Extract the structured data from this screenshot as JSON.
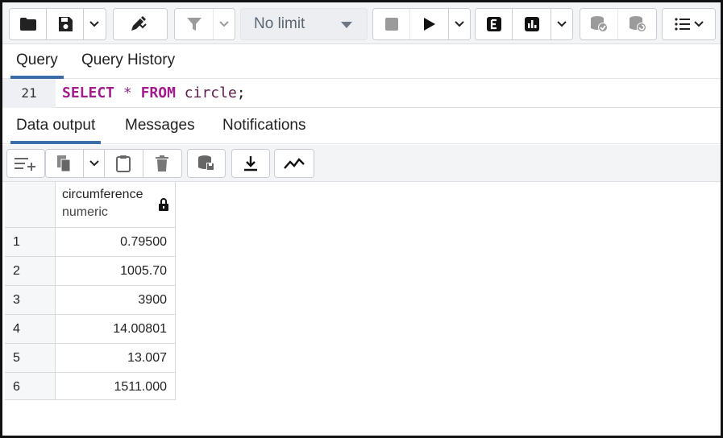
{
  "toolbar": {
    "limit_label": "No limit",
    "buttons": [
      {
        "name": "open-file",
        "icon": "folder-icon"
      },
      {
        "name": "save-file",
        "icon": "floppy-disk-icon"
      },
      {
        "name": "edit",
        "icon": "pen-icon"
      },
      {
        "name": "filter",
        "icon": "filter-icon"
      },
      {
        "name": "stop",
        "icon": "stop-icon"
      },
      {
        "name": "execute",
        "icon": "play-icon"
      },
      {
        "name": "explain",
        "icon": "explain-e-icon"
      },
      {
        "name": "explain-analyze",
        "icon": "bar-chart-icon"
      },
      {
        "name": "commit",
        "icon": "database-check-icon"
      },
      {
        "name": "rollback",
        "icon": "database-rollback-icon"
      },
      {
        "name": "macros",
        "icon": "list-icon"
      }
    ]
  },
  "query_tabs": [
    "Query",
    "Query History"
  ],
  "editor": {
    "line_number": "21",
    "code": {
      "kw1": "SELECT",
      "star": "*",
      "kw2": "FROM",
      "table": "circle",
      "semi": ";"
    }
  },
  "result_tabs": [
    "Data output",
    "Messages",
    "Notifications"
  ],
  "grid": {
    "column": {
      "name": "circumference",
      "type": "numeric"
    },
    "rows": [
      {
        "n": "1",
        "v": "0.79500"
      },
      {
        "n": "2",
        "v": "1005.70"
      },
      {
        "n": "3",
        "v": "3900"
      },
      {
        "n": "4",
        "v": "14.00801"
      },
      {
        "n": "5",
        "v": "13.007"
      },
      {
        "n": "6",
        "v": "1511.000"
      }
    ]
  },
  "colors": {
    "accent": "#3b6ea8",
    "keyword": "#a21c8c"
  }
}
